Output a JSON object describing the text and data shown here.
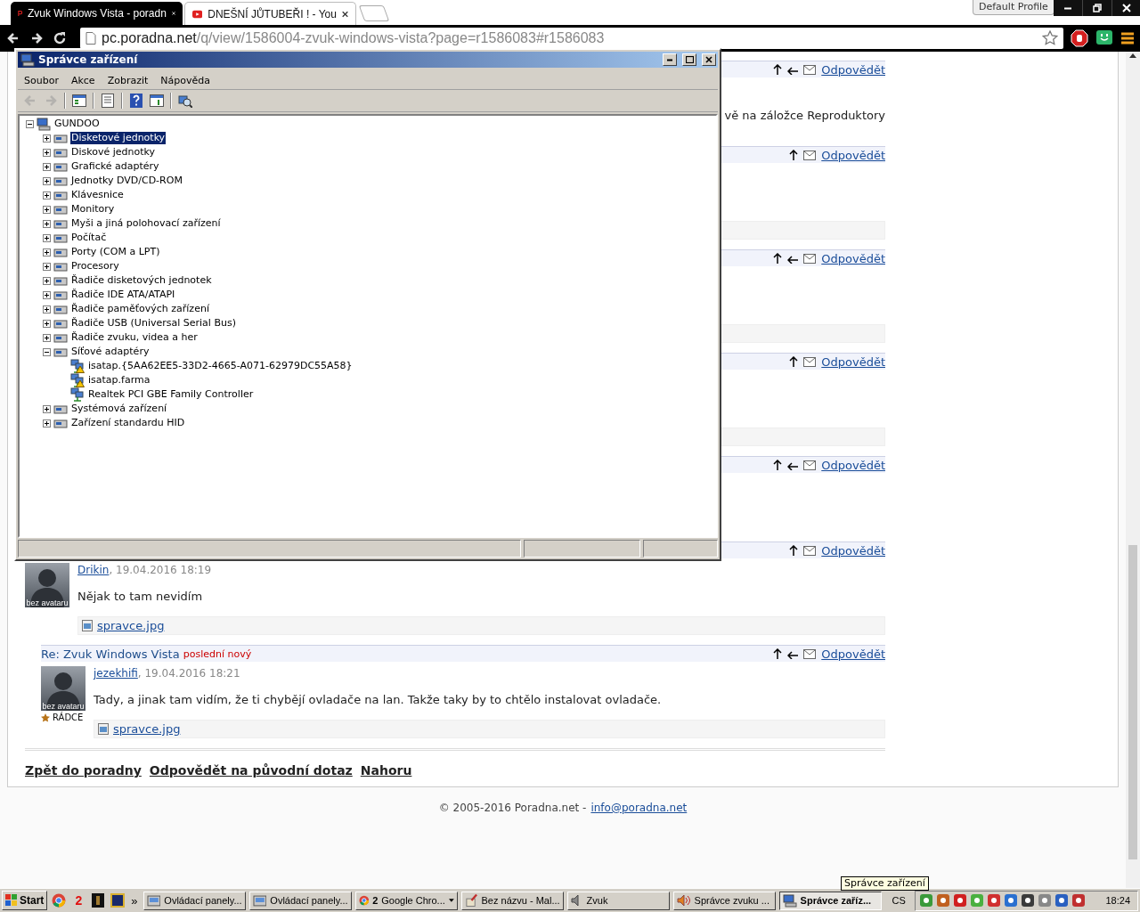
{
  "browser": {
    "tabs": [
      {
        "title": "Zvuk Windows Vista - poradn",
        "selected": true
      },
      {
        "title": "DNEŠNÍ JŮTUBEŘI ! - You",
        "selected": false
      }
    ],
    "profile": "Default Profile",
    "url": {
      "host": "pc.poradna.net",
      "path": "/q/view/1586004-zvuk-windows-vista?page=r1586083#r1586083"
    }
  },
  "thread": {
    "posts": [
      {
        "reply_arrow": true,
        "link": "Odpovědět",
        "text": "vě na záložce Reproduktory",
        "attachment": false
      },
      {
        "reply_arrow": false,
        "link": "Odpovědět",
        "attachment": true
      },
      {
        "reply_arrow": true,
        "link": "Odpovědět",
        "attachment": true
      },
      {
        "reply_arrow": false,
        "link": "Odpovědět",
        "attachment": true
      },
      {
        "reply_arrow": true,
        "link": "Odpovědět",
        "attachment": false
      },
      {
        "reply_arrow": false,
        "link": "Odpovědět",
        "author": "Drikin",
        "date": ", 19.04.2016 18:19",
        "avatar": "bez avataru",
        "text": "Nějak to tam nevidím",
        "attachment": true,
        "attachment_name": "spravce.jpg",
        "children": [
          {
            "title": "Re: Zvuk Windows Vista",
            "badge": "poslední nový",
            "reply_arrow": true,
            "link": "Odpovědět",
            "author": "jezekhifi",
            "date": ", 19.04.2016 18:21",
            "avatar": "bez avataru",
            "rank": "RÁDCE",
            "text": "Tady, a jinak tam vidím, že ti chybějí ovladače na lan. Takže taky by to chtělo instalovat ovladače.",
            "attachment": true,
            "attachment_name": "spravce.jpg"
          }
        ]
      }
    ],
    "footer_links": [
      "Zpět do poradny",
      "Odpovědět na původní dotaz",
      "Nahoru"
    ]
  },
  "copyright": "© 2005-2016 Poradna.net -",
  "email": "info@poradna.net",
  "device_manager": {
    "title": "Správce zařízení",
    "menu": [
      "Soubor",
      "Akce",
      "Zobrazit",
      "Nápověda"
    ],
    "toolbar": [
      {
        "kind": "back",
        "disabled": true
      },
      {
        "kind": "forward",
        "disabled": true
      },
      {
        "kind": "separator"
      },
      {
        "kind": "tree",
        "disabled": false
      },
      {
        "kind": "separator"
      },
      {
        "kind": "properties",
        "disabled": false
      },
      {
        "kind": "separator"
      },
      {
        "kind": "help",
        "disabled": false
      },
      {
        "kind": "pane",
        "disabled": false
      },
      {
        "kind": "separator"
      },
      {
        "kind": "scan",
        "disabled": false
      }
    ],
    "tree": {
      "label": "GUNDOO",
      "expanded": true,
      "selected": false,
      "children": [
        {
          "label": "Disketové jednotky",
          "expanded": false,
          "selected": true
        },
        {
          "label": "Diskové jednotky",
          "expanded": false,
          "selected": false
        },
        {
          "label": "Grafické adaptéry",
          "expanded": false,
          "selected": false
        },
        {
          "label": "Jednotky DVD/CD-ROM",
          "expanded": false,
          "selected": false
        },
        {
          "label": "Klávesnice",
          "expanded": false,
          "selected": false
        },
        {
          "label": "Monitory",
          "expanded": false,
          "selected": false
        },
        {
          "label": "Myši a jiná polohovací zařízení",
          "expanded": false,
          "selected": false
        },
        {
          "label": "Počítač",
          "expanded": false,
          "selected": false
        },
        {
          "label": "Porty (COM a LPT)",
          "expanded": false,
          "selected": false
        },
        {
          "label": "Procesory",
          "expanded": false,
          "selected": false
        },
        {
          "label": "Řadiče disketových jednotek",
          "expanded": false,
          "selected": false
        },
        {
          "label": "Řadiče IDE ATA/ATAPI",
          "expanded": false,
          "selected": false
        },
        {
          "label": "Řadiče paměťových zařízení",
          "expanded": false,
          "selected": false
        },
        {
          "label": "Řadiče USB (Universal Serial Bus)",
          "expanded": false,
          "selected": false
        },
        {
          "label": "Řadiče zvuku, videa a her",
          "expanded": false,
          "selected": false
        },
        {
          "label": "Síťové adaptéry",
          "expanded": true,
          "selected": false,
          "children": [
            {
              "label": "isatap.{5AA62EE5-33D2-4665-A071-62979DC55A58}",
              "warning": true,
              "selected": false
            },
            {
              "label": "isatap.farma",
              "warning": true,
              "selected": false
            },
            {
              "label": "Realtek PCI GBE Family Controller",
              "warning": false,
              "selected": false
            }
          ]
        },
        {
          "label": "Systémová zařízení",
          "expanded": false,
          "selected": false
        },
        {
          "label": "Zařízení standardu HID",
          "expanded": false,
          "selected": false
        }
      ]
    }
  },
  "taskbar": {
    "start": "Start",
    "quick_launch": [
      {
        "kind": "browser"
      },
      {
        "kind": "number",
        "text": "2"
      },
      {
        "kind": "dark"
      },
      {
        "kind": "square"
      }
    ],
    "more": "»",
    "tasks": [
      {
        "label": "Ovládací panely...",
        "kind": "folder",
        "selected": false
      },
      {
        "label": "Ovládací panely...",
        "kind": "folder",
        "selected": false
      },
      {
        "label": "Google Chro...",
        "count": "2",
        "kind": "browser",
        "selected": false
      },
      {
        "label": "Bez názvu - Mal...",
        "kind": "paint",
        "selected": false
      },
      {
        "label": "Zvuk",
        "kind": "sound",
        "selected": false
      },
      {
        "label": "Správce zvuku ...",
        "kind": "speaker",
        "selected": false
      },
      {
        "label": "Správce zaříz...",
        "kind": "devices",
        "selected": true
      }
    ],
    "language": "CS",
    "clock": "18:24"
  },
  "tooltip": "Správce zařízení"
}
